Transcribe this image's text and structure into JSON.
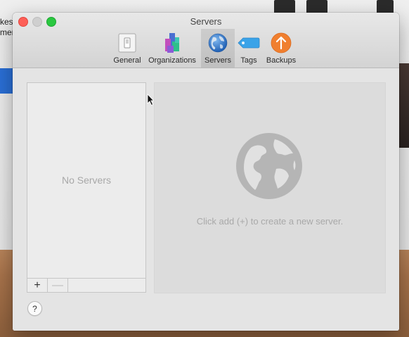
{
  "window": {
    "title": "Servers"
  },
  "toolbar": {
    "items": [
      {
        "label": "General",
        "icon": "general-switch-icon"
      },
      {
        "label": "Organizations",
        "icon": "organizations-blocks-icon"
      },
      {
        "label": "Servers",
        "icon": "globe-icon",
        "selected": true
      },
      {
        "label": "Tags",
        "icon": "tag-icon"
      },
      {
        "label": "Backups",
        "icon": "backup-arrow-icon"
      }
    ]
  },
  "server_list": {
    "empty_text": "No Servers",
    "add_label": "+",
    "remove_label": "—"
  },
  "detail": {
    "hint": "Click add (+) to create a new server."
  },
  "help": {
    "label": "?"
  },
  "background": {
    "text_fragment_1": "kes",
    "text_fragment_2": "mer"
  },
  "colors": {
    "close": "#fd5f57",
    "minimize": "#cfcfcf",
    "zoom": "#2ac840",
    "tag_blue": "#3aa3e8",
    "backup_orange": "#f07f2f"
  }
}
